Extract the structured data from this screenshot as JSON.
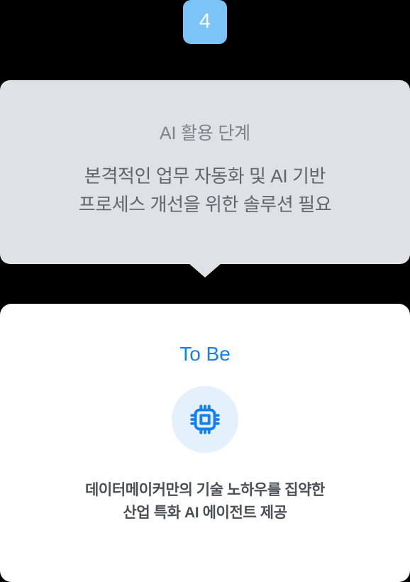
{
  "step": {
    "number": "4"
  },
  "bubble": {
    "title": "AI 활용 단계",
    "body_line1": "본격적인 업무 자동화 및 AI 기반",
    "body_line2": "프로세스 개선을 위한 솔루션 필요"
  },
  "card": {
    "heading": "To Be",
    "icon": "cpu-chip-icon",
    "desc_line1": "데이터메이커만의 기술 노하우를 집약한",
    "desc_line2": "산업 특화 AI 에이전트 제공"
  },
  "colors": {
    "badge_bg": "#7CC4F8",
    "badge_text": "#FFFFFF",
    "bubble_bg": "#DFE2E5",
    "bubble_title_text": "#7C8288",
    "bubble_body_text": "#61666C",
    "card_bg": "#FFFFFF",
    "accent_blue": "#1380F5",
    "icon_circle_bg": "#E4F1FD",
    "card_desc_text": "#4B5056",
    "page_bg": "#000000"
  }
}
